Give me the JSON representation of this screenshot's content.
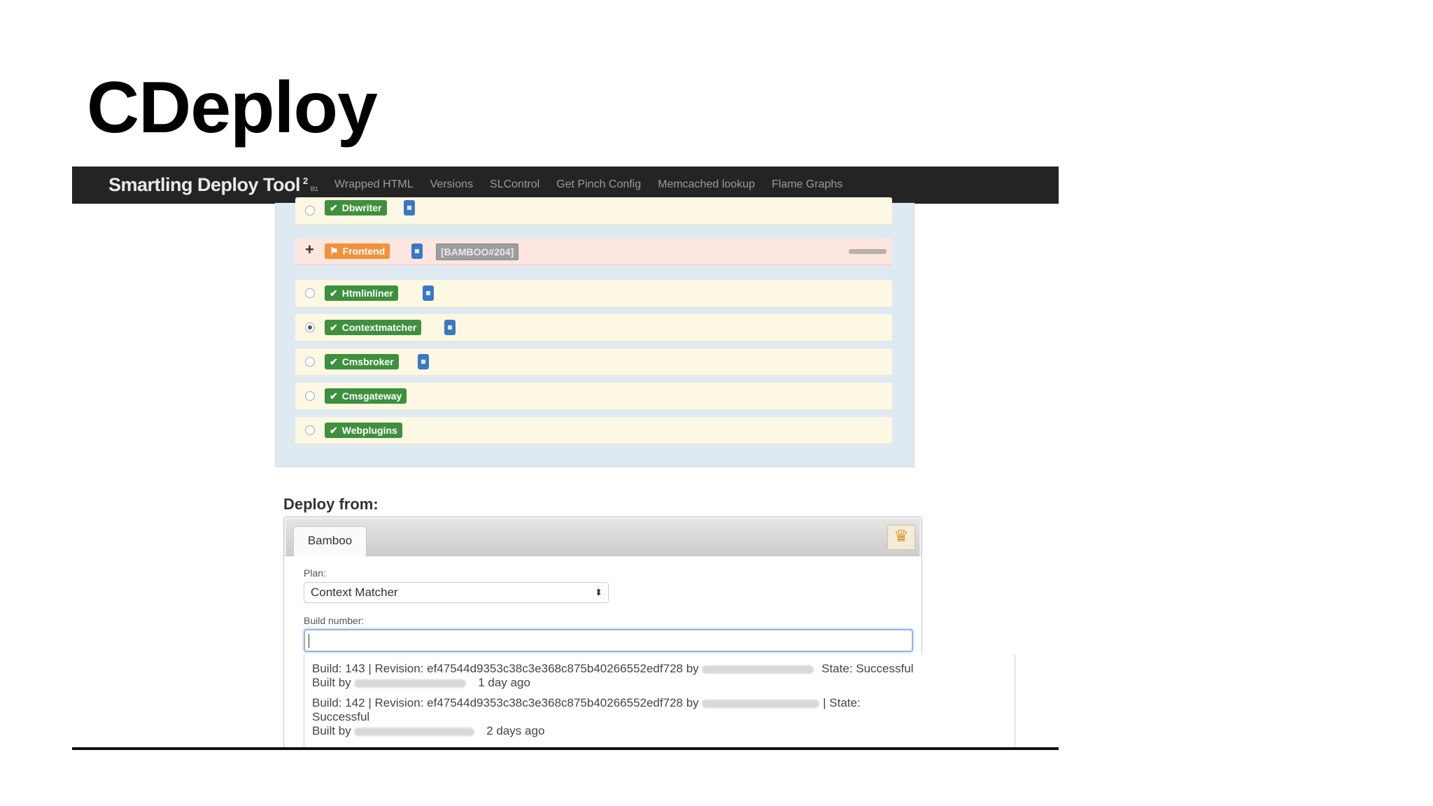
{
  "slide": {
    "title": "CDeploy"
  },
  "navbar": {
    "brand": "Smartling Deploy Tool",
    "brand_sup": "2",
    "brand_sub": "B1",
    "links": [
      "Wrapped HTML",
      "Versions",
      "SLControl",
      "Get Pinch Config",
      "Memcached lookup",
      "Flame Graphs"
    ]
  },
  "services": [
    {
      "name": "Dbwriter",
      "status": "ok",
      "selected": false
    },
    {
      "name": "Frontend",
      "status": "warning",
      "build_tag": "[BAMBOO#204]"
    },
    {
      "name": "Htmlinliner",
      "status": "ok",
      "selected": false
    },
    {
      "name": "Contextmatcher",
      "status": "ok",
      "selected": true
    },
    {
      "name": "Cmsbroker",
      "status": "ok",
      "selected": false
    },
    {
      "name": "Cmsgateway",
      "status": "ok",
      "selected": false
    },
    {
      "name": "Webplugins",
      "status": "ok",
      "selected": false
    }
  ],
  "deploy": {
    "heading": "Deploy from:",
    "tab": "Bamboo",
    "plan_label": "Plan:",
    "plan_value": "Context Matcher",
    "build_label": "Build number:",
    "build_value": ""
  },
  "suggestions": [
    {
      "line1": "Build: 143 | Revision: ef47544d9353c38c3e368c875b40266552edf728 by",
      "state": "State: Successful",
      "built_by": "Built by",
      "ago": "1 day ago"
    },
    {
      "line1": "Build: 142 | Revision: ef47544d9353c38c3e368c875b40266552edf728 by",
      "state": "| State:",
      "state2": "Successful",
      "built_by": "Built by",
      "ago": "2 days ago"
    }
  ],
  "colors": {
    "navbar": "#242424",
    "ok_label": "#3e8f3e",
    "warn_label": "#f0923b",
    "info": "#3a78c3"
  }
}
